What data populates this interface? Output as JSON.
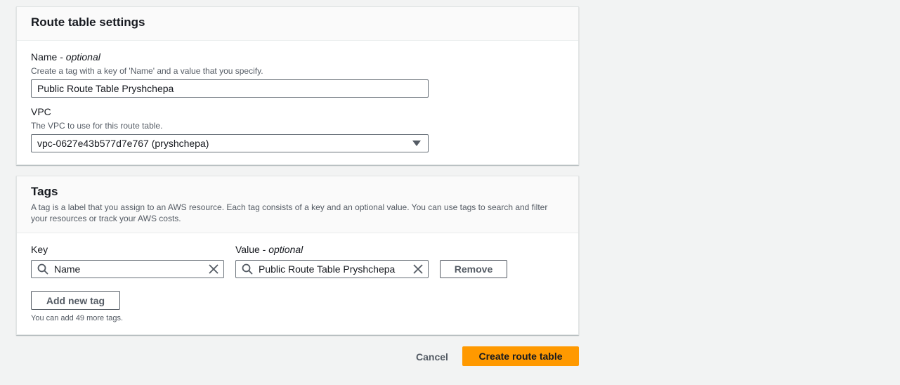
{
  "route_table_settings": {
    "title": "Route table settings",
    "name_label": "Name - ",
    "name_optional": "optional",
    "name_description": "Create a tag with a key of 'Name' and a value that you specify.",
    "name_value": "Public Route Table Pryshchepa",
    "vpc_label": "VPC",
    "vpc_description": "The VPC to use for this route table.",
    "vpc_value": "vpc-0627e43b577d7e767 (pryshchepa)"
  },
  "tags": {
    "title": "Tags",
    "description_line1": "A tag is a label that you assign to an AWS resource. Each tag consists of a key and an optional value. You can use tags to search and filter",
    "description_line2": "your resources or track your AWS costs.",
    "key_label": "Key",
    "value_label": "Value - ",
    "value_optional": "optional",
    "rows": [
      {
        "key": "Name",
        "value": "Public Route Table Pryshchepa"
      }
    ],
    "remove_label": "Remove",
    "add_label": "Add new tag",
    "limit_text": "You can add 49 more tags."
  },
  "footer": {
    "cancel_label": "Cancel",
    "create_label": "Create route table"
  },
  "colors": {
    "primary_button": "#ff9900",
    "background": "#f2f3f3",
    "border": "#687078"
  },
  "icons": {
    "dropdown": "caret-down-icon",
    "search": "search-icon",
    "clear": "clear-icon"
  }
}
